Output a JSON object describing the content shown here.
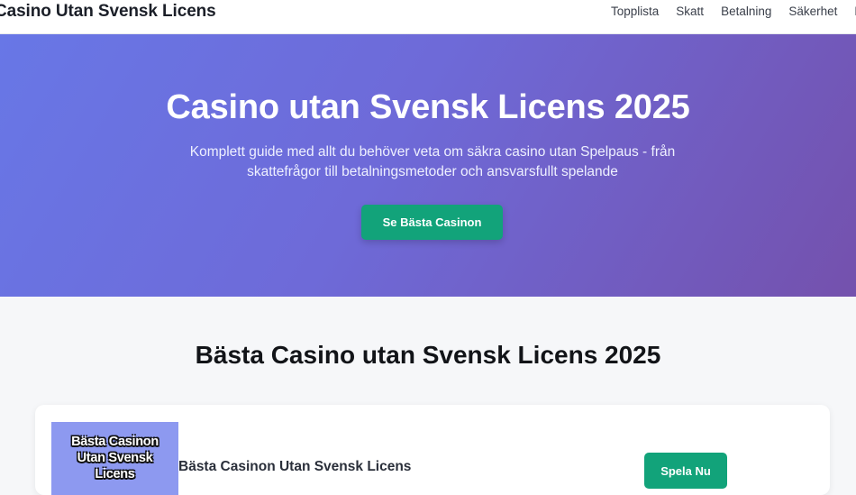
{
  "header": {
    "brand": "Casino Utan Svensk Licens",
    "nav": [
      "Topplista",
      "Skatt",
      "Betalning",
      "Säkerhet",
      "F"
    ]
  },
  "hero": {
    "title": "Casino utan Svensk Licens 2025",
    "subtitle": "Komplett guide med allt du behöver veta om säkra casino utan Spelpaus - från skattefrågor till betalningsmetoder och ansvarsfullt spelande",
    "cta_label": "Se Bästa Casinon"
  },
  "section": {
    "title": "Bästa Casino utan Svensk Licens 2025"
  },
  "card": {
    "logo_lines": [
      "Bästa Casinon",
      "Utan Svensk",
      "Licens"
    ],
    "name": "Bästa Casinon Utan Svensk Licens",
    "play_label": "Spela Nu"
  },
  "colors": {
    "hero_start": "#6877e6",
    "hero_end": "#7451ad",
    "accent_green": "#12a37a"
  }
}
